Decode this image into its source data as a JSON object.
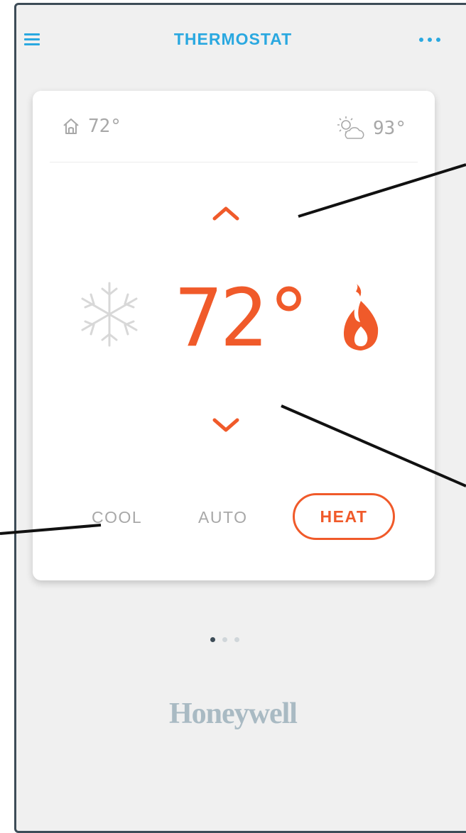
{
  "header": {
    "title": "THERMOSTAT"
  },
  "card": {
    "indoor_temp": "72°",
    "outdoor_temp": "93°",
    "setpoint": "72°",
    "modes": {
      "cool": "COOL",
      "auto": "AUTO",
      "heat": "HEAT"
    },
    "selected_mode": "HEAT"
  },
  "pager": {
    "page_count": 3,
    "active_page": 1
  },
  "brand": "Honeywell",
  "colors": {
    "accent": "#2aa8e0",
    "heat": "#f05a2a",
    "muted": "#a8a8a8",
    "background": "#f0f0f0",
    "card": "#ffffff"
  },
  "icons": [
    "menu-icon",
    "more-icon",
    "home-icon",
    "weather-icon",
    "chevron-up-icon",
    "chevron-down-icon",
    "snowflake-icon",
    "flame-icon"
  ]
}
